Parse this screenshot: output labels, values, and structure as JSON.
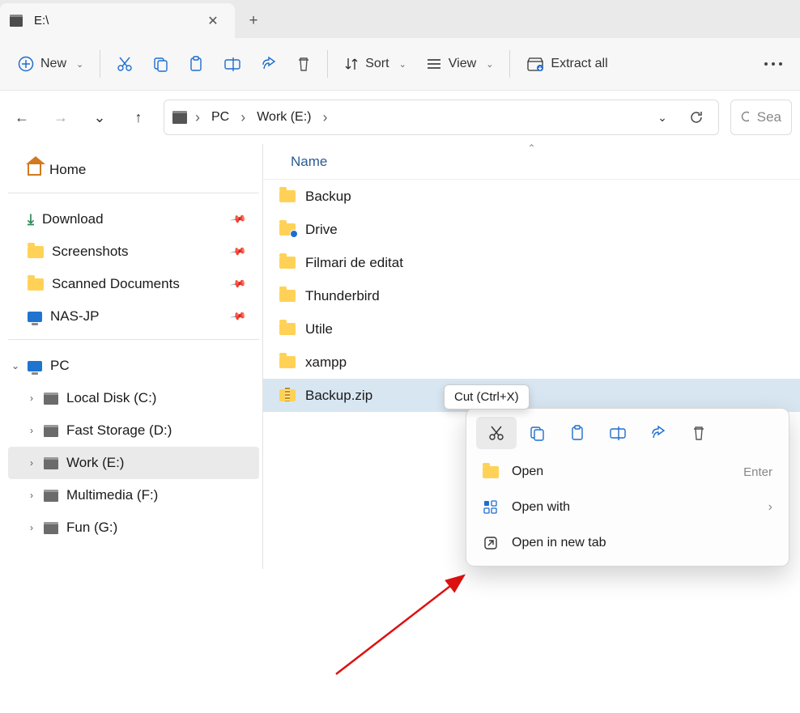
{
  "tab": {
    "title": "E:\\",
    "close": "✕",
    "newtab": "+"
  },
  "toolbar": {
    "new": "New",
    "sort": "Sort",
    "view": "View",
    "extract": "Extract all"
  },
  "nav": {
    "back": "←",
    "fwd": "→",
    "recent": "⌄",
    "up": "↑"
  },
  "breadcrumbs": [
    "PC",
    "Work (E:)"
  ],
  "search": {
    "placeholder": "Sea"
  },
  "sidebar": {
    "home": "Home",
    "quick": [
      {
        "label": "Download",
        "icon": "dl"
      },
      {
        "label": "Screenshots",
        "icon": "folder"
      },
      {
        "label": "Scanned Documents",
        "icon": "folder"
      },
      {
        "label": "NAS-JP",
        "icon": "monitor"
      }
    ],
    "pc": "PC",
    "drives": [
      {
        "label": "Local Disk (C:)",
        "exp": "›"
      },
      {
        "label": "Fast Storage (D:)",
        "exp": "›"
      },
      {
        "label": "Work (E:)",
        "exp": "›",
        "sel": true
      },
      {
        "label": "Multimedia (F:)",
        "exp": "›"
      },
      {
        "label": "Fun (G:)",
        "exp": "›"
      }
    ]
  },
  "content": {
    "column": "Name",
    "items": [
      {
        "name": "Backup",
        "type": "folder"
      },
      {
        "name": "Drive",
        "type": "drive-folder"
      },
      {
        "name": "Filmari de editat",
        "type": "folder"
      },
      {
        "name": "Thunderbird",
        "type": "folder"
      },
      {
        "name": "Utile",
        "type": "folder"
      },
      {
        "name": "xampp",
        "type": "folder"
      },
      {
        "name": "Backup.zip",
        "type": "zip",
        "sel": true
      }
    ]
  },
  "tooltip": "Cut (Ctrl+X)",
  "ctxt": {
    "open": "Open",
    "open_kb": "Enter",
    "openwith": "Open with",
    "opentab": "Open in new tab"
  }
}
